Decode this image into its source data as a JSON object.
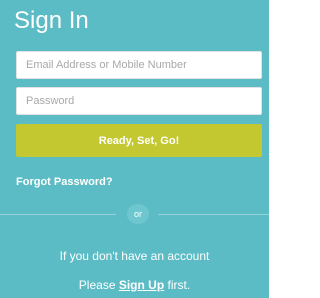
{
  "header": {
    "title": "Sign In"
  },
  "form": {
    "email_placeholder": "Email Address or Mobile Number",
    "password_placeholder": "Password",
    "submit_label": "Ready, Set, Go!",
    "forgot_label": "Forgot Password?"
  },
  "separator": {
    "label": "or"
  },
  "signup": {
    "prompt": "If you don't have an account",
    "prefix": "Please",
    "link_label": "Sign Up",
    "suffix": "first."
  },
  "colors": {
    "background": "#5cbcc5",
    "button": "#c3c830",
    "text": "#ffffff"
  }
}
